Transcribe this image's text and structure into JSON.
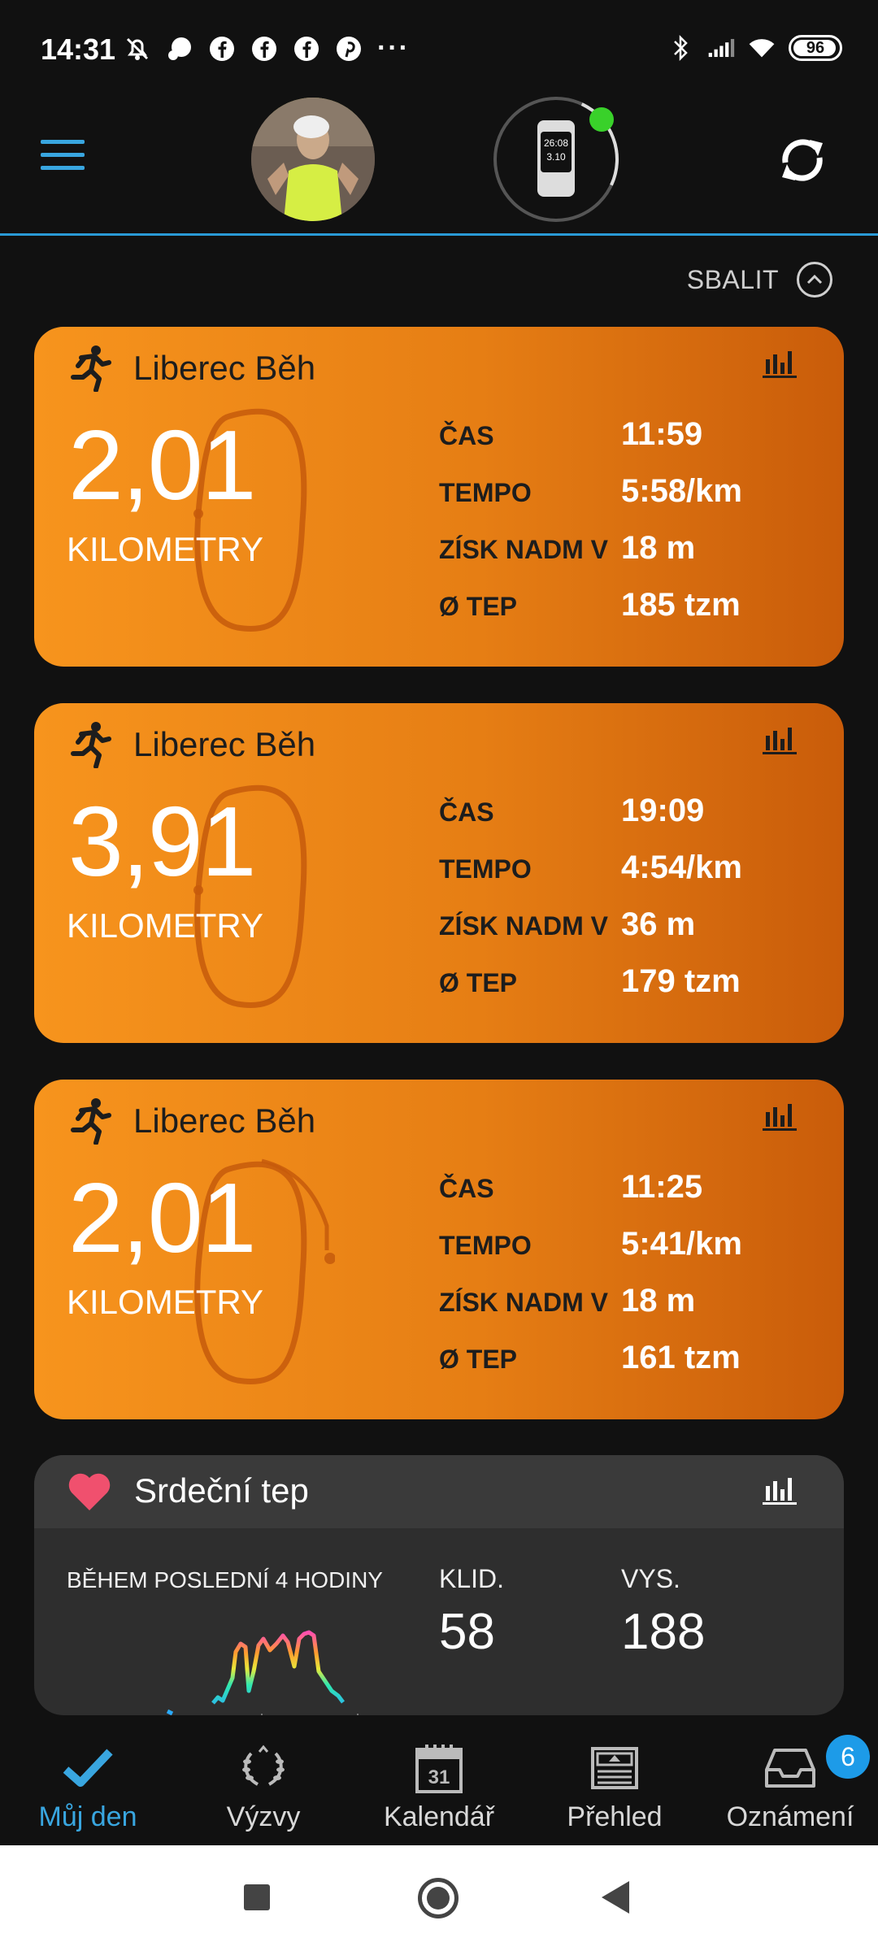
{
  "status_bar": {
    "time": "14:31",
    "more": "···",
    "battery": "96",
    "icons": [
      "mute-icon",
      "chat-bubble-icon",
      "facebook-icon",
      "facebook-icon",
      "facebook-icon",
      "pinterest-icon",
      "bluetooth-icon",
      "signal-icon",
      "wifi-icon",
      "battery-icon"
    ]
  },
  "header": {
    "menu_icon": "hamburger-icon",
    "avatar": "profile-photo",
    "device_icon": "watch-icon",
    "device_screen_line1": "26:08",
    "device_screen_line2": "3.10",
    "sync_icon": "sync-icon",
    "status_color": "#39d12a",
    "accent": "#2a9ad6"
  },
  "collapse": {
    "label": "SBALIT"
  },
  "activities": [
    {
      "title": "Liberec Běh",
      "distance": "2,01",
      "unit": "KILOMETRY",
      "metrics": [
        {
          "label": "ČAS",
          "value": "11:59"
        },
        {
          "label": "TEMPO",
          "value": "5:58/km"
        },
        {
          "label": "ZÍSK NADM V",
          "value": "18 m"
        },
        {
          "label": "Ø TEP",
          "value": "185 tzm"
        }
      ]
    },
    {
      "title": "Liberec Běh",
      "distance": "3,91",
      "unit": "KILOMETRY",
      "metrics": [
        {
          "label": "ČAS",
          "value": "19:09"
        },
        {
          "label": "TEMPO",
          "value": "4:54/km"
        },
        {
          "label": "ZÍSK NADM V",
          "value": "36 m"
        },
        {
          "label": "Ø TEP",
          "value": "179 tzm"
        }
      ]
    },
    {
      "title": "Liberec Běh",
      "distance": "2,01",
      "unit": "KILOMETRY",
      "metrics": [
        {
          "label": "ČAS",
          "value": "11:25"
        },
        {
          "label": "TEMPO",
          "value": "5:41/km"
        },
        {
          "label": "ZÍSK NADM V",
          "value": "18 m"
        },
        {
          "label": "Ø TEP",
          "value": "161 tzm"
        }
      ]
    }
  ],
  "heart_rate": {
    "title": "Srdeční tep",
    "period": "BĚHEM POSLEDNÍ 4 HODINY",
    "rest_label": "KLID.",
    "rest_value": "58",
    "high_label": "VYS.",
    "high_value": "188"
  },
  "bottom_nav": [
    {
      "label": "Můj den",
      "icon": "checkmark-icon",
      "active": true
    },
    {
      "label": "Výzvy",
      "icon": "laurel-icon"
    },
    {
      "label": "Kalendář",
      "icon": "calendar-icon",
      "icon_text": "31"
    },
    {
      "label": "Přehled",
      "icon": "newsfeed-icon"
    },
    {
      "label": "Oznámení",
      "icon": "inbox-icon",
      "badge": "6"
    }
  ],
  "colors": {
    "activity_card": "#f7941d",
    "activity_card_dark": "#c95c0a",
    "accent_blue": "#39a6e0",
    "heart": "#f0506e"
  }
}
